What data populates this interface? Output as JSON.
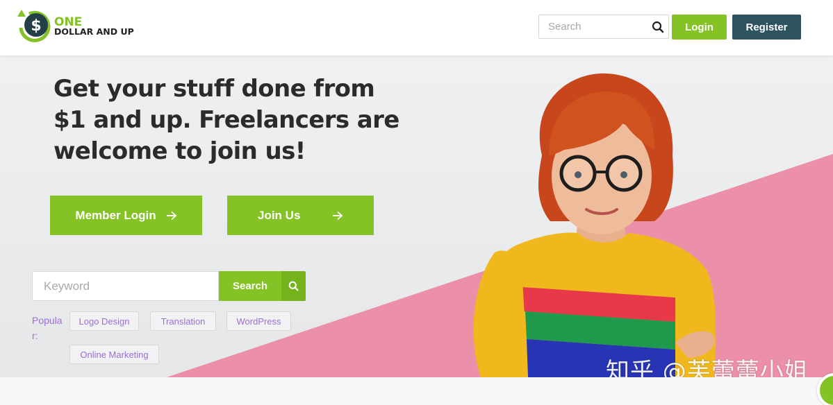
{
  "brand": {
    "logo_line1": "ONE",
    "logo_line2": "DOLLAR AND UP",
    "logo_symbol": "$",
    "accent_color": "#84c225",
    "dark_color": "#2d5360"
  },
  "header": {
    "search_placeholder": "Search",
    "search_icon": "search-icon",
    "login_label": "Login",
    "register_label": "Register"
  },
  "hero": {
    "title": "Get your stuff done from $1 and up. Freelancers are welcome to join us!",
    "member_login_label": "Member Login",
    "join_us_label": "Join Us",
    "keyword_placeholder": "Keyword",
    "search_label": "Search",
    "popular_label": "Popular:",
    "popular_tags": [
      "Logo Design",
      "Translation",
      "WordPress",
      "Online Marketing"
    ],
    "pink_color": "#ec8fa8",
    "tag_text_color": "#9b6dd6"
  },
  "watermark": "知乎 @芙蕾蕾小姐"
}
